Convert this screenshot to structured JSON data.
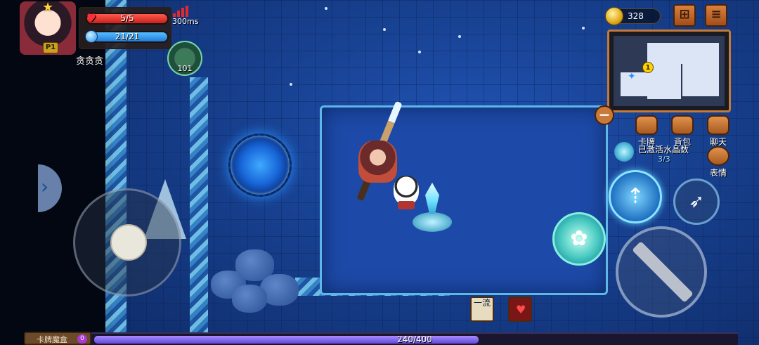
{
  "player": {
    "hp": "5/5",
    "mp": "21/21",
    "name": "贪贪贪",
    "badge": "P1",
    "ping": "300ms",
    "buff_count": "101",
    "hp_fraction": 1.0,
    "mp_fraction": 1.0
  },
  "currency": {
    "coins": "328"
  },
  "menu": {
    "cards": "卡牌",
    "backpack": "背包",
    "chat": "聊天",
    "emote": "表情"
  },
  "crystals": {
    "label": "已激活水晶数",
    "count": "3/3"
  },
  "minimap": {
    "marker": "1"
  },
  "bottom": {
    "card_box_label": "卡牌魔盒",
    "card_box_count": "0",
    "exp": "240/400",
    "exp_fraction": 0.6
  },
  "items": {
    "scroll_label": "一流"
  },
  "colors": {
    "hp": "#e0302a",
    "mp": "#2f8fe6",
    "exp": "#7b5fe8",
    "ui_orange": "#c97a3a"
  },
  "icons": {
    "side_tab": "chevron-right-icon",
    "collapse": "minus-icon",
    "skill_spear": "spear-icon",
    "skill_arrow": "arrow-icon",
    "skill_ally": "ally-summon-icon",
    "attack": "sword-icon"
  }
}
